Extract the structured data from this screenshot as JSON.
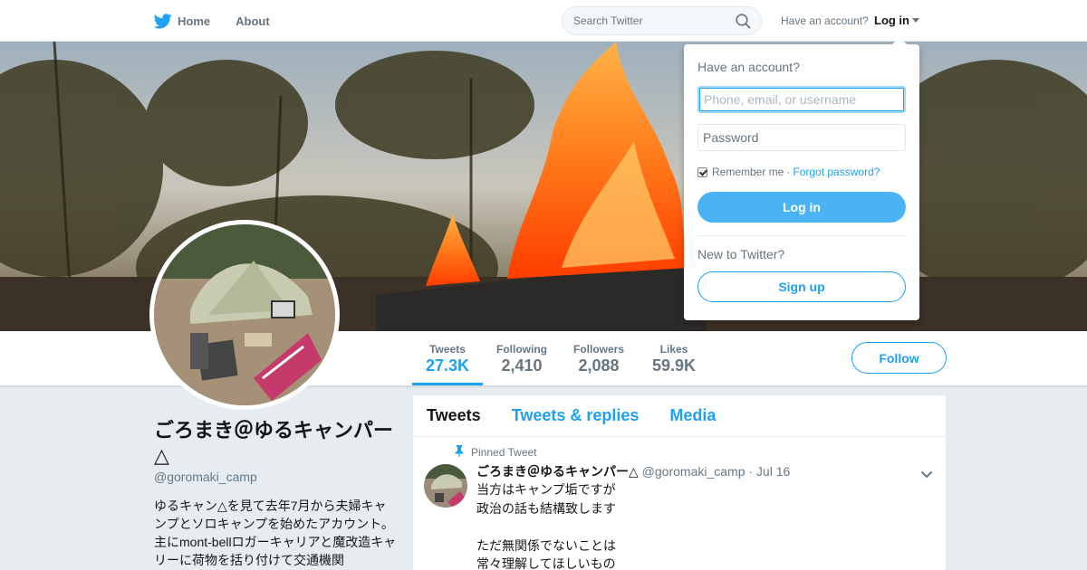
{
  "nav": {
    "home": "Home",
    "about": "About",
    "search_placeholder": "Search Twitter",
    "have_account": "Have an account?",
    "login": "Log in"
  },
  "login_dropdown": {
    "title": "Have an account?",
    "username_placeholder": "Phone, email, or username",
    "password_placeholder": "Password",
    "remember": "Remember me",
    "separator": "·",
    "forgot": "Forgot password?",
    "login_button": "Log in",
    "new_to_twitter": "New to Twitter?",
    "signup_button": "Sign up"
  },
  "stats": [
    {
      "label": "Tweets",
      "value": "27.3K"
    },
    {
      "label": "Following",
      "value": "2,410"
    },
    {
      "label": "Followers",
      "value": "2,088"
    },
    {
      "label": "Likes",
      "value": "59.9K"
    }
  ],
  "follow_button": "Follow",
  "profile": {
    "name": "ごろまき＠ゆるキャンパー△",
    "handle": "@goromaki_camp",
    "bio": "ゆるキャン△を見て去年7月から夫婦キャンプとソロキャンプを始めたアカウント。主にmont-bellロガーキャリアと魔改造キャリーに荷物を括り付けて交通機関"
  },
  "timeline": {
    "tabs": [
      "Tweets",
      "Tweets & replies",
      "Media"
    ],
    "pinned_label": "Pinned Tweet",
    "tweet": {
      "name": "ごろまき＠ゆるキャンパー△",
      "handle": "@goromaki_camp",
      "date": "· Jul 16",
      "lines": [
        "当方はキャンプ垢ですが",
        "政治の話も結構致します",
        "",
        "ただ無関係でないことは",
        "常々理解してほしいもの"
      ]
    }
  },
  "colors": {
    "accent": "#1da1f2",
    "background": "#e6ecf0",
    "login_button": "#4ab3f4"
  }
}
